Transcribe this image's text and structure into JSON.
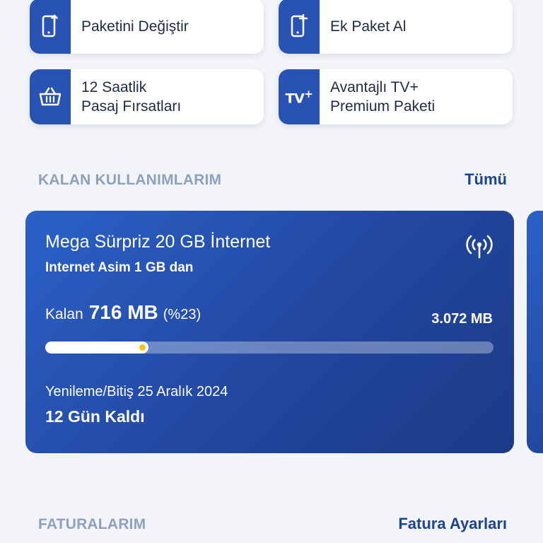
{
  "quick_actions": [
    {
      "label": "Paketini Değiştir",
      "icon": "phone-upgrade-icon"
    },
    {
      "label": "Ek Paket Al",
      "icon": "phone-add-icon"
    },
    {
      "label": "12 Saatlik\nPasaj Fırsatları",
      "icon": "basket-icon"
    },
    {
      "label": "Avantajlı TV+\nPremium Paketi",
      "icon": "tv-plus-icon"
    }
  ],
  "usage_section": {
    "title": "KALAN KULLANIMLARIM",
    "link": "Tümü"
  },
  "usage_card": {
    "package_name": "Mega Sürpriz 20 GB İnternet",
    "subtitle": "Internet Asim 1 GB dan",
    "remaining_label": "Kalan",
    "remaining_value": "716 MB",
    "remaining_percent": "(%23)",
    "total": "3.072 MB",
    "progress_fraction": 0.23,
    "renewal_text": "Yenileme/Bitiş 25 Aralık 2024",
    "days_left": "12 Gün Kaldı",
    "icon": "signal-tower-icon"
  },
  "bills_section": {
    "title": "FATURALARIM",
    "link": "Fatura Ayarları"
  },
  "colors": {
    "accent": "#2852b4",
    "link": "#1c4394",
    "section_title": "#8ea0bf",
    "progress_dot": "#f5c518",
    "background": "#f2f4f8"
  }
}
